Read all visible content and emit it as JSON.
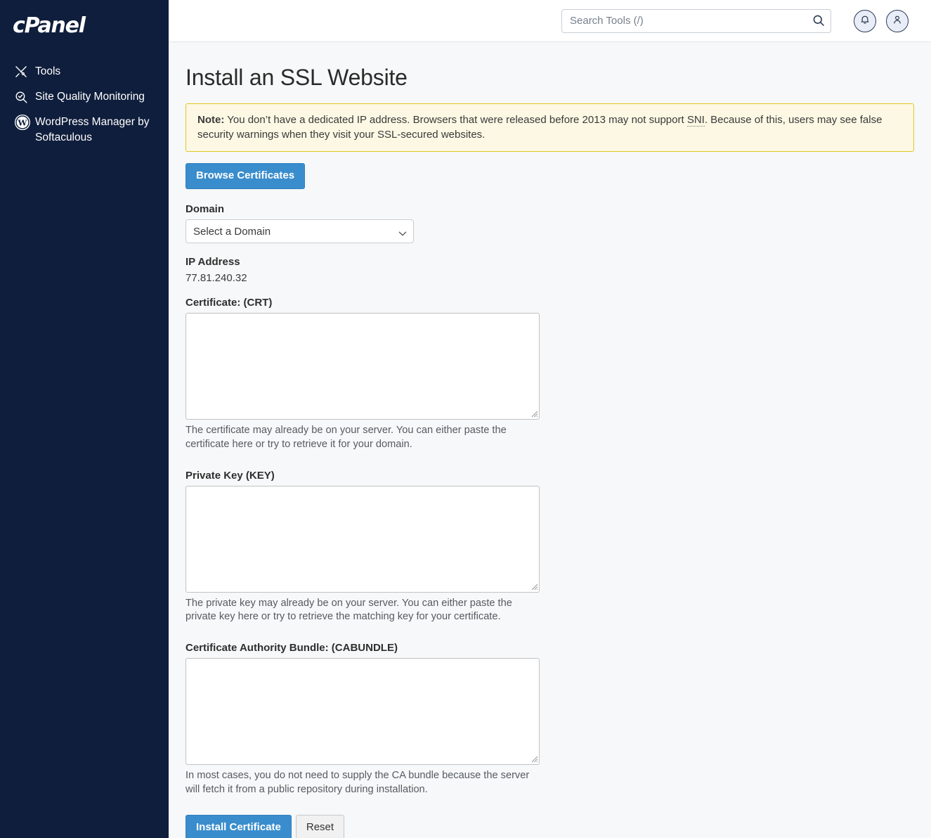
{
  "sidebar": {
    "brand": "cPanel",
    "items": [
      {
        "label": "Tools",
        "icon": "tools-icon"
      },
      {
        "label": "Site Quality Monitoring",
        "icon": "site-quality-icon"
      },
      {
        "label": "WordPress Manager by Softaculous",
        "icon": "wordpress-icon"
      }
    ]
  },
  "topbar": {
    "search_placeholder": "Search Tools (/)",
    "search_value": "",
    "search_icon": "search-icon",
    "notifications_icon": "bell-icon",
    "account_icon": "user-icon"
  },
  "page": {
    "title": "Install an SSL Website"
  },
  "note": {
    "prefix": "Note:",
    "text_before_abbr": " You don’t have a dedicated IP address. Browsers that were released before 2013 may not support ",
    "abbr": "SNI",
    "text_after_abbr": ". Because of this, users may see false security warnings when they visit your SSL-secured websites."
  },
  "browse": {
    "label": "Browse Certificates"
  },
  "domain": {
    "label": "Domain",
    "selected": "Select a Domain",
    "options": [
      "Select a Domain"
    ],
    "chevron_icon": "chevron-down-icon"
  },
  "ip": {
    "label": "IP Address",
    "value": "77.81.240.32"
  },
  "certificate": {
    "label": "Certificate: (CRT)",
    "value": "",
    "help": "The certificate may already be on your server. You can either paste the certificate here or try to retrieve it for your domain."
  },
  "private_key": {
    "label": "Private Key (KEY)",
    "value": "",
    "help": "The private key may already be on your server. You can either paste the private key here or try to retrieve the matching key for your certificate."
  },
  "cabundle": {
    "label": "Certificate Authority Bundle: (CABUNDLE)",
    "value": "",
    "help": "In most cases, you do not need to supply the CA bundle because the server will fetch it from a public repository during installation."
  },
  "actions": {
    "install_label": "Install Certificate",
    "reset_label": "Reset"
  },
  "colors": {
    "sidebar_bg": "#0f1e3c",
    "primary_button": "#3a8dcc",
    "note_bg": "#fcf8e4",
    "note_border": "#e2c822",
    "page_bg": "#f7f8f9"
  }
}
